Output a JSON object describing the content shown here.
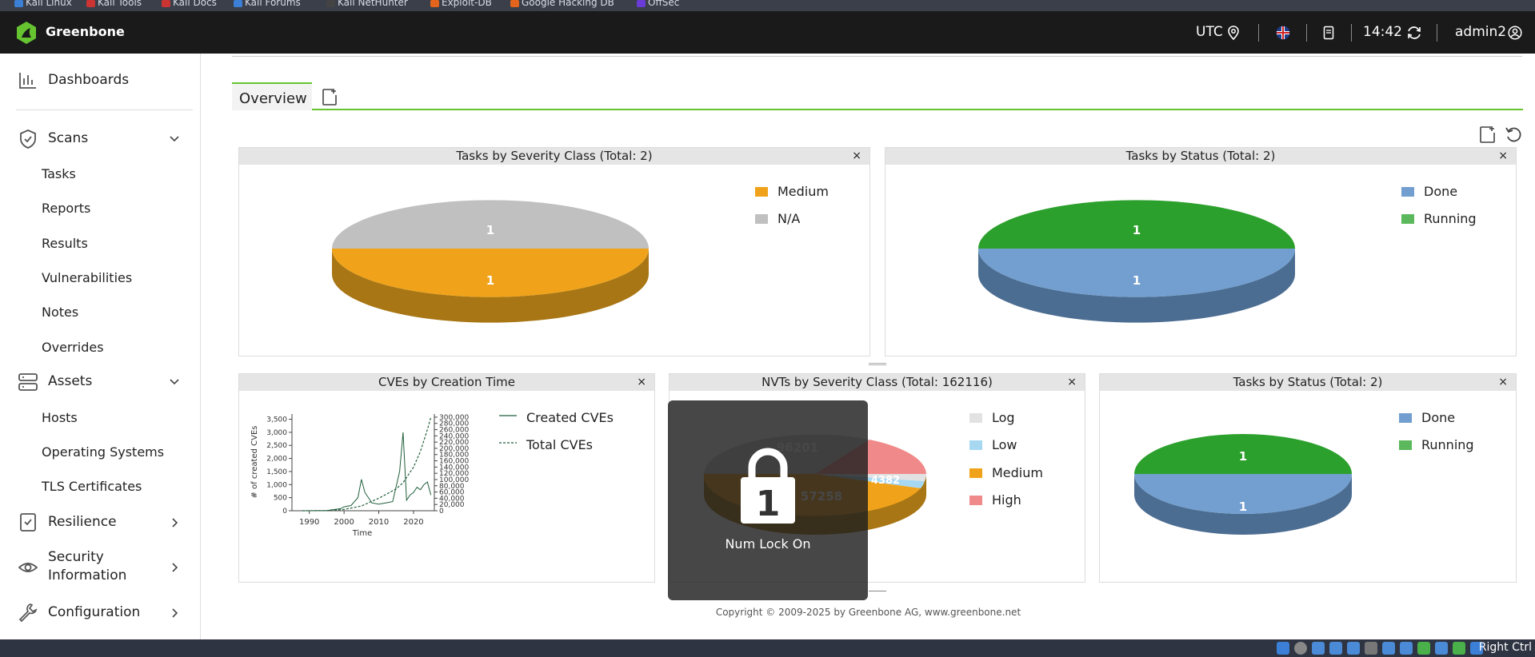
{
  "browser_bookmarks": [
    "Kali Linux",
    "Kali Tools",
    "Kali Docs",
    "Kali Forums",
    "Kali NetHunter",
    "Exploit-DB",
    "Google Hacking DB",
    "OffSec"
  ],
  "topbar": {
    "brand": "Greenbone",
    "timezone": "UTC",
    "time": "14:42",
    "user": "admin2"
  },
  "sidebar": {
    "dashboards": "Dashboards",
    "scans": "Scans",
    "scans_items": [
      "Tasks",
      "Reports",
      "Results",
      "Vulnerabilities",
      "Notes",
      "Overrides"
    ],
    "assets": "Assets",
    "assets_items": [
      "Hosts",
      "Operating Systems",
      "TLS Certificates"
    ],
    "resilience": "Resilience",
    "security_line1": "Security",
    "security_line2": "Information",
    "configuration": "Configuration"
  },
  "tabs": {
    "overview": "Overview"
  },
  "panels": {
    "p1": {
      "title": "Tasks by Severity Class (Total: 2)",
      "close": "×",
      "legend": [
        "Medium",
        "N/A"
      ],
      "top_label": "1",
      "bottom_label": "1"
    },
    "p2": {
      "title": "Tasks by Status (Total: 2)",
      "close": "×",
      "legend": [
        "Done",
        "Running"
      ],
      "top_label": "1",
      "bottom_label": "1"
    },
    "p3": {
      "title": "CVEs by Creation Time",
      "close": "×",
      "legend": [
        "Created CVEs",
        "Total CVEs"
      ],
      "ylabel": "# of created CVEs",
      "xlabel": "Time",
      "y_ticks": [
        "3,500",
        "3,000",
        "2,500",
        "2,000",
        "1,500",
        "1,000",
        "500",
        "0"
      ],
      "y2_ticks": [
        "300,000",
        "280,000",
        "260,000",
        "240,000",
        "220,000",
        "200,000",
        "180,000",
        "160,000",
        "140,000",
        "120,000",
        "100,000",
        "80,000",
        "60,000",
        "40,000",
        "20,000",
        "0"
      ],
      "x_ticks": [
        "1990",
        "2000",
        "2010",
        "2020"
      ]
    },
    "p4": {
      "title": "NVTs by Severity Class (Total: 162116)",
      "close": "×",
      "legend": [
        "Log",
        "Low",
        "Medium",
        "High"
      ],
      "labels": [
        "96201",
        "4382",
        "57258"
      ]
    },
    "p5": {
      "title": "Tasks by Status (Total: 2)",
      "close": "×",
      "legend": [
        "Done",
        "Running"
      ],
      "top_label": "1",
      "bottom_label": "1"
    }
  },
  "colors": {
    "medium": "#f0a31a",
    "na": "#c0c0c0",
    "done": "#729fcf",
    "running": "#2ca02c",
    "log": "#e2e2e2",
    "low": "#a6d8f2",
    "high": "#f08a8a",
    "accent": "#66c430"
  },
  "chart_data": [
    {
      "type": "pie",
      "title": "Tasks by Severity Class (Total: 2)",
      "categories": [
        "Medium",
        "N/A"
      ],
      "values": [
        1,
        1
      ]
    },
    {
      "type": "pie",
      "title": "Tasks by Status (Total: 2)",
      "categories": [
        "Done",
        "Running"
      ],
      "values": [
        1,
        1
      ]
    },
    {
      "type": "line",
      "title": "CVEs by Creation Time",
      "xlabel": "Time",
      "ylabel": "# of created CVEs",
      "series": [
        {
          "name": "Created CVEs",
          "x": [
            1988,
            1995,
            1999,
            2000,
            2002,
            2004,
            2005,
            2006,
            2008,
            2010,
            2012,
            2014,
            2016,
            2017,
            2018,
            2019,
            2020,
            2021,
            2022,
            2023,
            2024,
            2025
          ],
          "values": [
            0,
            10,
            80,
            150,
            200,
            500,
            1200,
            700,
            300,
            250,
            300,
            350,
            1500,
            3000,
            400,
            600,
            700,
            900,
            800,
            1000,
            1100,
            600
          ]
        },
        {
          "name": "Total CVEs",
          "x": [
            1988,
            1995,
            2000,
            2005,
            2010,
            2015,
            2017,
            2020,
            2022,
            2024,
            2025
          ],
          "values": [
            0,
            500,
            4000,
            15000,
            40000,
            70000,
            90000,
            140000,
            190000,
            260000,
            300000
          ]
        }
      ],
      "ylim": [
        0,
        3700
      ],
      "y2lim": [
        0,
        310000
      ]
    },
    {
      "type": "pie",
      "title": "NVTs by Severity Class (Total: 162116)",
      "categories": [
        "Log",
        "Low",
        "Medium",
        "High"
      ],
      "values": [
        96201,
        4382,
        57258,
        4275
      ]
    },
    {
      "type": "pie",
      "title": "Tasks by Status (Total: 2)",
      "categories": [
        "Done",
        "Running"
      ],
      "values": [
        1,
        1
      ]
    }
  ],
  "numlock": {
    "text": "Num Lock On",
    "digit": "1"
  },
  "footer": "Copyright © 2009-2025 by Greenbone AG, www.greenbone.net",
  "taskbar": {
    "right_label": "Right Ctrl"
  }
}
